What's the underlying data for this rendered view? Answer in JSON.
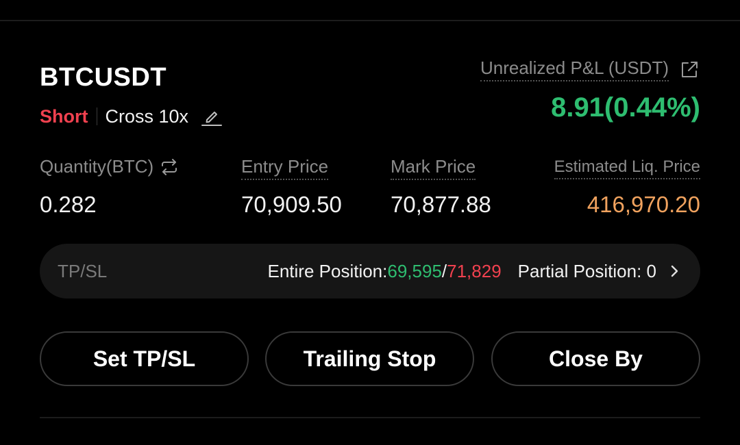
{
  "position": {
    "symbol": "BTCUSDT",
    "side": "Short",
    "margin_mode": "Cross 10x"
  },
  "pnl": {
    "label": "Unrealized P&L (USDT)",
    "value": "8.91(0.44%)"
  },
  "stats": {
    "quantity_label": "Quantity(BTC)",
    "quantity_value": "0.282",
    "entry_label": "Entry Price",
    "entry_value": "70,909.50",
    "mark_label": "Mark Price",
    "mark_value": "70,877.88",
    "liq_label": "Estimated Liq. Price",
    "liq_value": "416,970.20"
  },
  "tpsl": {
    "title": "TP/SL",
    "entire_label": "Entire Position: ",
    "tp_value": "69,595",
    "separator": "/",
    "sl_value": "71,829",
    "partial_label": "Partial Position: 0"
  },
  "buttons": {
    "set_tpsl": "Set TP/SL",
    "trailing_stop": "Trailing Stop",
    "close_by": "Close By"
  },
  "icons": {
    "edit": "pencil-icon",
    "share": "external-link-icon",
    "swap": "swap-arrows-icon",
    "chevron": "chevron-right-icon"
  },
  "colors": {
    "profit_green": "#2ebd70",
    "loss_red": "#f0414f",
    "liq_orange": "#f0a25e",
    "muted_gray": "#8c8c8c"
  }
}
